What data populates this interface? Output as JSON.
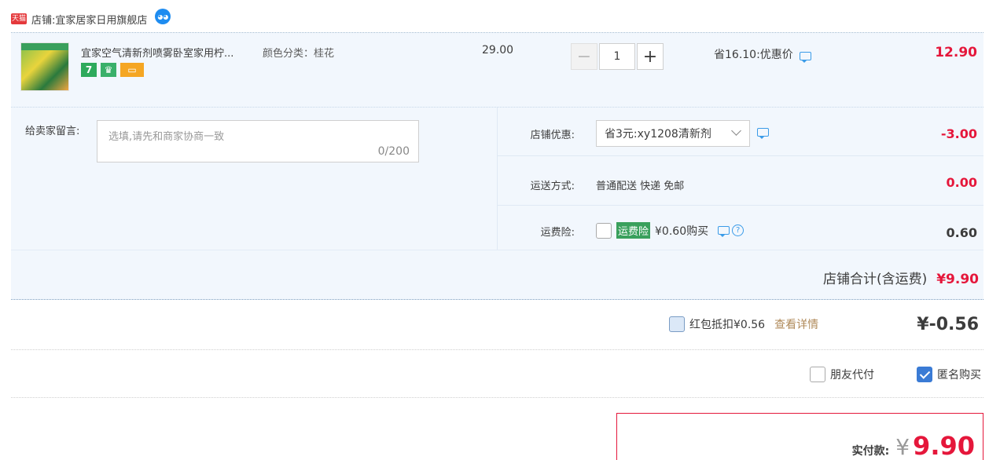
{
  "shop": {
    "badge": "天猫",
    "prefix": "店铺: ",
    "name": "宜家居家日用旗舰店"
  },
  "item": {
    "title": "宜家空气清新剂喷雾卧室家用柠...",
    "spec": "颜色分类：桂花",
    "unit_price": "29.00",
    "quantity": "1",
    "promo": "省16.10:优惠价",
    "total": "12.90",
    "badge_seven": "7"
  },
  "memo": {
    "label": "给卖家留言:",
    "placeholder": "选填,请先和商家协商一致",
    "count": "0/200"
  },
  "options": {
    "coupon": {
      "label": "店铺优惠:",
      "value": "省3元:xy1208清新剂",
      "amount": "-3.00"
    },
    "shipping": {
      "label": "运送方式:",
      "value": "普通配送 快递 免邮",
      "amount": "0.00"
    },
    "insurance": {
      "label": "运费险:",
      "tag": "运费险",
      "value": "¥0.60购买",
      "amount": "0.60"
    }
  },
  "shop_total": {
    "label": "店铺合计(含运费)",
    "value": "¥9.90"
  },
  "redpack": {
    "label": "红包抵扣¥0.56",
    "link": "查看详情",
    "amount": "¥-0.56"
  },
  "pay_options": {
    "friend": "朋友代付",
    "anonymous": "匿名购买"
  },
  "payment": {
    "label": "实付款:",
    "currency": "¥",
    "amount": "9.90"
  },
  "colors": {
    "accent_red": "#e5173b",
    "row_bg": "#f2f7fd",
    "link_blue": "#3a9be8",
    "green": "#3aa05c"
  }
}
